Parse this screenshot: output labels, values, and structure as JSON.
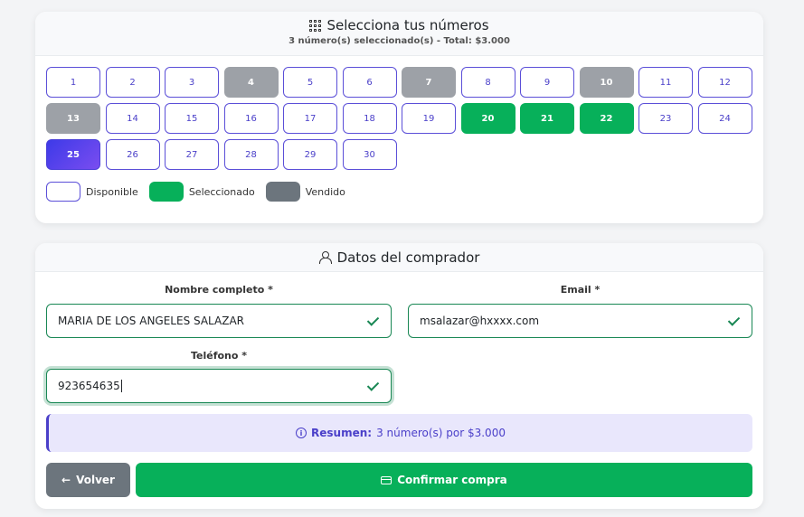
{
  "numbers_section": {
    "title": "Selecciona tus números",
    "subtitle": "3 número(s) seleccionado(s) - Total: $3.000",
    "icon": "grid-icon",
    "numbers": [
      {
        "n": "1",
        "state": "available"
      },
      {
        "n": "2",
        "state": "available"
      },
      {
        "n": "3",
        "state": "available"
      },
      {
        "n": "4",
        "state": "sold"
      },
      {
        "n": "5",
        "state": "available"
      },
      {
        "n": "6",
        "state": "available"
      },
      {
        "n": "7",
        "state": "sold"
      },
      {
        "n": "8",
        "state": "available"
      },
      {
        "n": "9",
        "state": "available"
      },
      {
        "n": "10",
        "state": "sold"
      },
      {
        "n": "11",
        "state": "available"
      },
      {
        "n": "12",
        "state": "available"
      },
      {
        "n": "13",
        "state": "sold"
      },
      {
        "n": "14",
        "state": "available"
      },
      {
        "n": "15",
        "state": "available"
      },
      {
        "n": "16",
        "state": "available"
      },
      {
        "n": "17",
        "state": "available"
      },
      {
        "n": "18",
        "state": "available"
      },
      {
        "n": "19",
        "state": "available"
      },
      {
        "n": "20",
        "state": "selected"
      },
      {
        "n": "21",
        "state": "selected"
      },
      {
        "n": "22",
        "state": "selected"
      },
      {
        "n": "23",
        "state": "available"
      },
      {
        "n": "24",
        "state": "available"
      },
      {
        "n": "25",
        "state": "current"
      },
      {
        "n": "26",
        "state": "available"
      },
      {
        "n": "27",
        "state": "available"
      },
      {
        "n": "28",
        "state": "available"
      },
      {
        "n": "29",
        "state": "available"
      },
      {
        "n": "30",
        "state": "available"
      }
    ],
    "legend": {
      "available": "Disponible",
      "selected": "Seleccionado",
      "sold": "Vendido"
    }
  },
  "buyer_section": {
    "title": "Datos del comprador",
    "icon": "person-icon",
    "name_label": "Nombre completo *",
    "name_value": "MARIA DE LOS ANGELES SALAZAR",
    "email_label": "Email *",
    "email_value": "msalazar@hxxxx.com",
    "phone_label": "Teléfono *",
    "phone_value": "923654635",
    "summary_label": "Resumen:",
    "summary_text": "3 número(s) por $3.000",
    "back_button": "Volver",
    "confirm_button": "Confirmar compra"
  },
  "colors": {
    "accent": "#4a3fc9",
    "selected": "#07b05a",
    "sold": "#9da1a7",
    "back_button": "#6c757d"
  }
}
